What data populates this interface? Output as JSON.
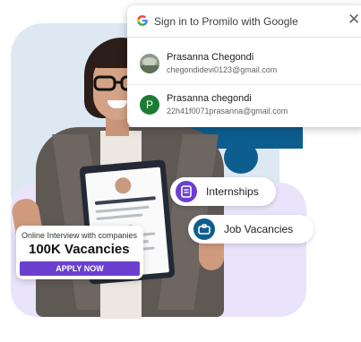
{
  "popup": {
    "title": "Sign in to Promilo with Google",
    "accounts": [
      {
        "name": "Prasanna Chegondi",
        "email": "chegondidevi0123@gmail.com",
        "avatar_letter": ""
      },
      {
        "name": "Prasanna chegondi",
        "email": "22h41f0071prasanna@gmail.com",
        "avatar_letter": "P"
      }
    ]
  },
  "card": {
    "subtitle": "Online Interview with companies",
    "headline": "100K Vacancies",
    "button": "APPLY NOW"
  },
  "chips": {
    "internships": "Internships",
    "jobs": "Job Vacancies"
  },
  "colors": {
    "accent_purple": "#6b3fcf",
    "puzzle_blue": "#0d5d8f",
    "avatar_green": "#1e7b34"
  }
}
